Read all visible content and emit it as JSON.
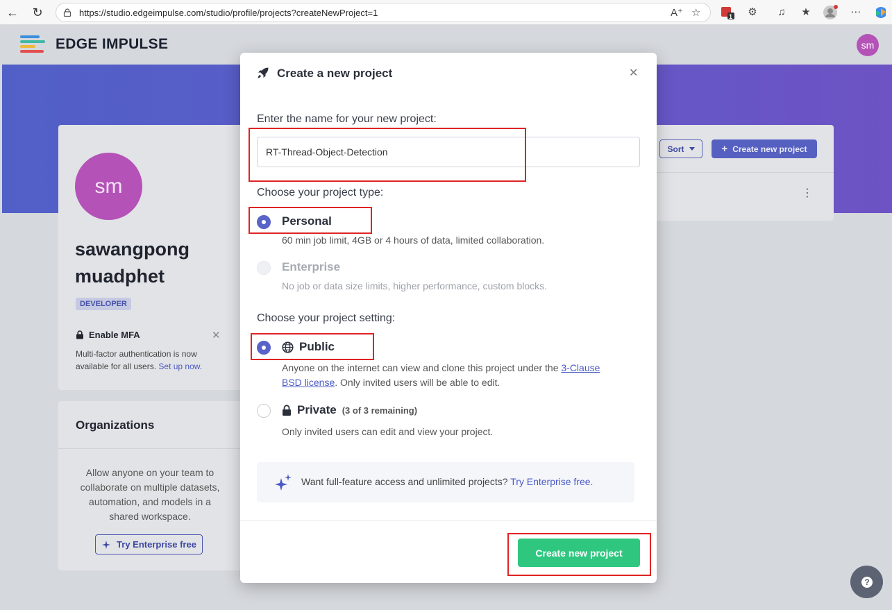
{
  "browser": {
    "url": "https://studio.edgeimpulse.com/studio/profile/projects?createNewProject=1",
    "badge_count": "1"
  },
  "header": {
    "logo_text": "EDGE IMPULSE",
    "avatar_initials": "sm"
  },
  "profile": {
    "avatar_initials": "sm",
    "name": "sawangpong muadphet",
    "role_badge": "DEVELOPER",
    "mfa_title": "Enable MFA",
    "mfa_text": "Multi-factor authentication is now available for all users. ",
    "mfa_link": "Set up now",
    "mfa_text_end": "."
  },
  "organizations": {
    "title": "Organizations",
    "description": "Allow anyone on your team to collaborate on multiple datasets, automation, and models in a shared workspace.",
    "button_label": "Try Enterprise free"
  },
  "projects_panel": {
    "sort_label": "Sort",
    "create_label": "Create new project"
  },
  "modal": {
    "title": "Create a new project",
    "name_label": "Enter the name for your new project:",
    "name_value": "RT-Thread-Object-Detection",
    "type_label": "Choose your project type:",
    "type_options": [
      {
        "label": "Personal",
        "desc": "60 min job limit, 4GB or 4 hours of data, limited collaboration.",
        "state": "selected"
      },
      {
        "label": "Enterprise",
        "desc": "No job or data size limits, higher performance, custom blocks.",
        "state": "disabled"
      }
    ],
    "setting_label": "Choose your project setting:",
    "public": {
      "label": "Public",
      "desc_start": "Anyone on the internet can view and clone this project under the ",
      "desc_link": "3-Clause BSD license",
      "desc_end": ". Only invited users will be able to edit."
    },
    "private": {
      "label": "Private",
      "remaining": "(3 of 3 remaining)",
      "desc": "Only invited users can edit and view your project."
    },
    "promo_text": "Want full-feature access and unlimited projects? ",
    "promo_link": "Try Enterprise free.",
    "create_button": "Create new project"
  },
  "colors": {
    "accent": "#5a64c8",
    "create_green": "#2fc780",
    "hero_gradient_start": "#5160c7",
    "hero_gradient_end": "#6d53c4",
    "avatar": "#b452b8",
    "highlight_red": "#e02323"
  }
}
